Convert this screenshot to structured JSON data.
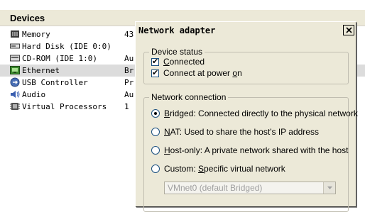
{
  "devices_panel": {
    "title": "Devices",
    "devices": [
      {
        "name": "Memory",
        "summary": "43",
        "icon": "memory-icon",
        "selected": false
      },
      {
        "name": "Hard Disk (IDE 0:0)",
        "summary": "",
        "icon": "hard-disk-icon",
        "selected": false
      },
      {
        "name": "CD-ROM (IDE 1:0)",
        "summary": "Au",
        "icon": "cdrom-icon",
        "selected": false
      },
      {
        "name": "Ethernet",
        "summary": "Br",
        "icon": "ethernet-icon",
        "selected": true
      },
      {
        "name": "USB Controller",
        "summary": "Pr",
        "icon": "usb-icon",
        "selected": false
      },
      {
        "name": "Audio",
        "summary": "Au",
        "icon": "audio-icon",
        "selected": false
      },
      {
        "name": "Virtual Processors",
        "summary": "1",
        "icon": "processor-icon",
        "selected": false
      }
    ]
  },
  "dialog": {
    "title": "Network adapter",
    "close_label": "×",
    "device_status": {
      "legend": "Device status",
      "connected": {
        "label_pre": "",
        "label_accel": "C",
        "label_post": "onnected",
        "checked": true
      },
      "connect_at_power_on": {
        "label_pre": "Connect at power ",
        "label_accel": "o",
        "label_post": "n",
        "checked": true
      }
    },
    "network_connection": {
      "legend": "Network connection",
      "options": [
        {
          "label_pre": "",
          "label_accel": "B",
          "label_post": "ridged: Connected directly to the physical network",
          "selected": true
        },
        {
          "label_pre": "",
          "label_accel": "N",
          "label_post": "AT: Used to share the host's IP address",
          "selected": false
        },
        {
          "label_pre": "",
          "label_accel": "H",
          "label_post": "ost-only: A private network shared with the host",
          "selected": false
        },
        {
          "label_pre": "Custom: ",
          "label_accel": "S",
          "label_post": "pecific virtual network",
          "selected": false
        }
      ],
      "vmnet_value": "VMnet0 (default Bridged)"
    }
  },
  "colors": {
    "dialog_bg": "#ece9d8",
    "selected_row": "#dcdcdc",
    "control_border": "#1c5180"
  }
}
